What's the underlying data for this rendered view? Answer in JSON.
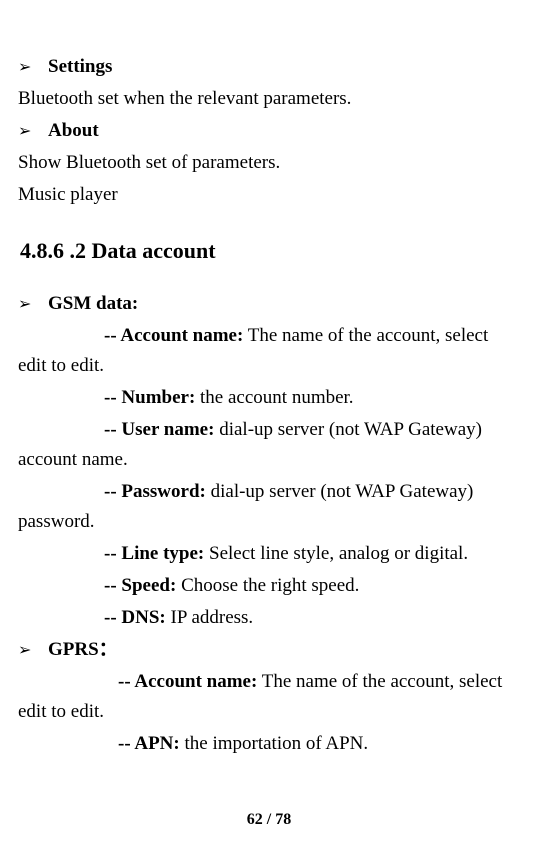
{
  "bullets": {
    "settings_label": "Settings",
    "about_label": "About",
    "gsm_label": "GSM data:",
    "gprs_label": "GPRS："
  },
  "bullet_marker": "➢",
  "lines": {
    "settings_body": "Bluetooth set when the relevant parameters.",
    "about_body": "Show Bluetooth set of parameters.",
    "music_player": "Music player"
  },
  "section": {
    "data_account": "4.8.6 .2 Data account"
  },
  "gsm": {
    "account_name_label": "-- Account name:",
    "account_name_body": " The name of the account, select edit to edit.",
    "number_label": "-- Number:",
    "number_body": " the account number.",
    "user_name_label": "-- User name:",
    "user_name_body": " dial-up server (not WAP Gateway) account name.",
    "password_label": "-- Password:",
    "password_body": " dial-up server (not WAP Gateway) password.",
    "line_type_label": "-- Line type:",
    "line_type_body": " Select line style, analog or digital.",
    "speed_label": "-- Speed:",
    "speed_body": " Choose the right speed.",
    "dns_label": "-- DNS:",
    "dns_body": " IP address."
  },
  "gprs": {
    "account_name_label": "-- Account name:",
    "account_name_body": " The name of the account, select edit to edit.",
    "apn_label": "-- APN:",
    "apn_body": " the importation of APN."
  },
  "page_number": "62 / 78"
}
